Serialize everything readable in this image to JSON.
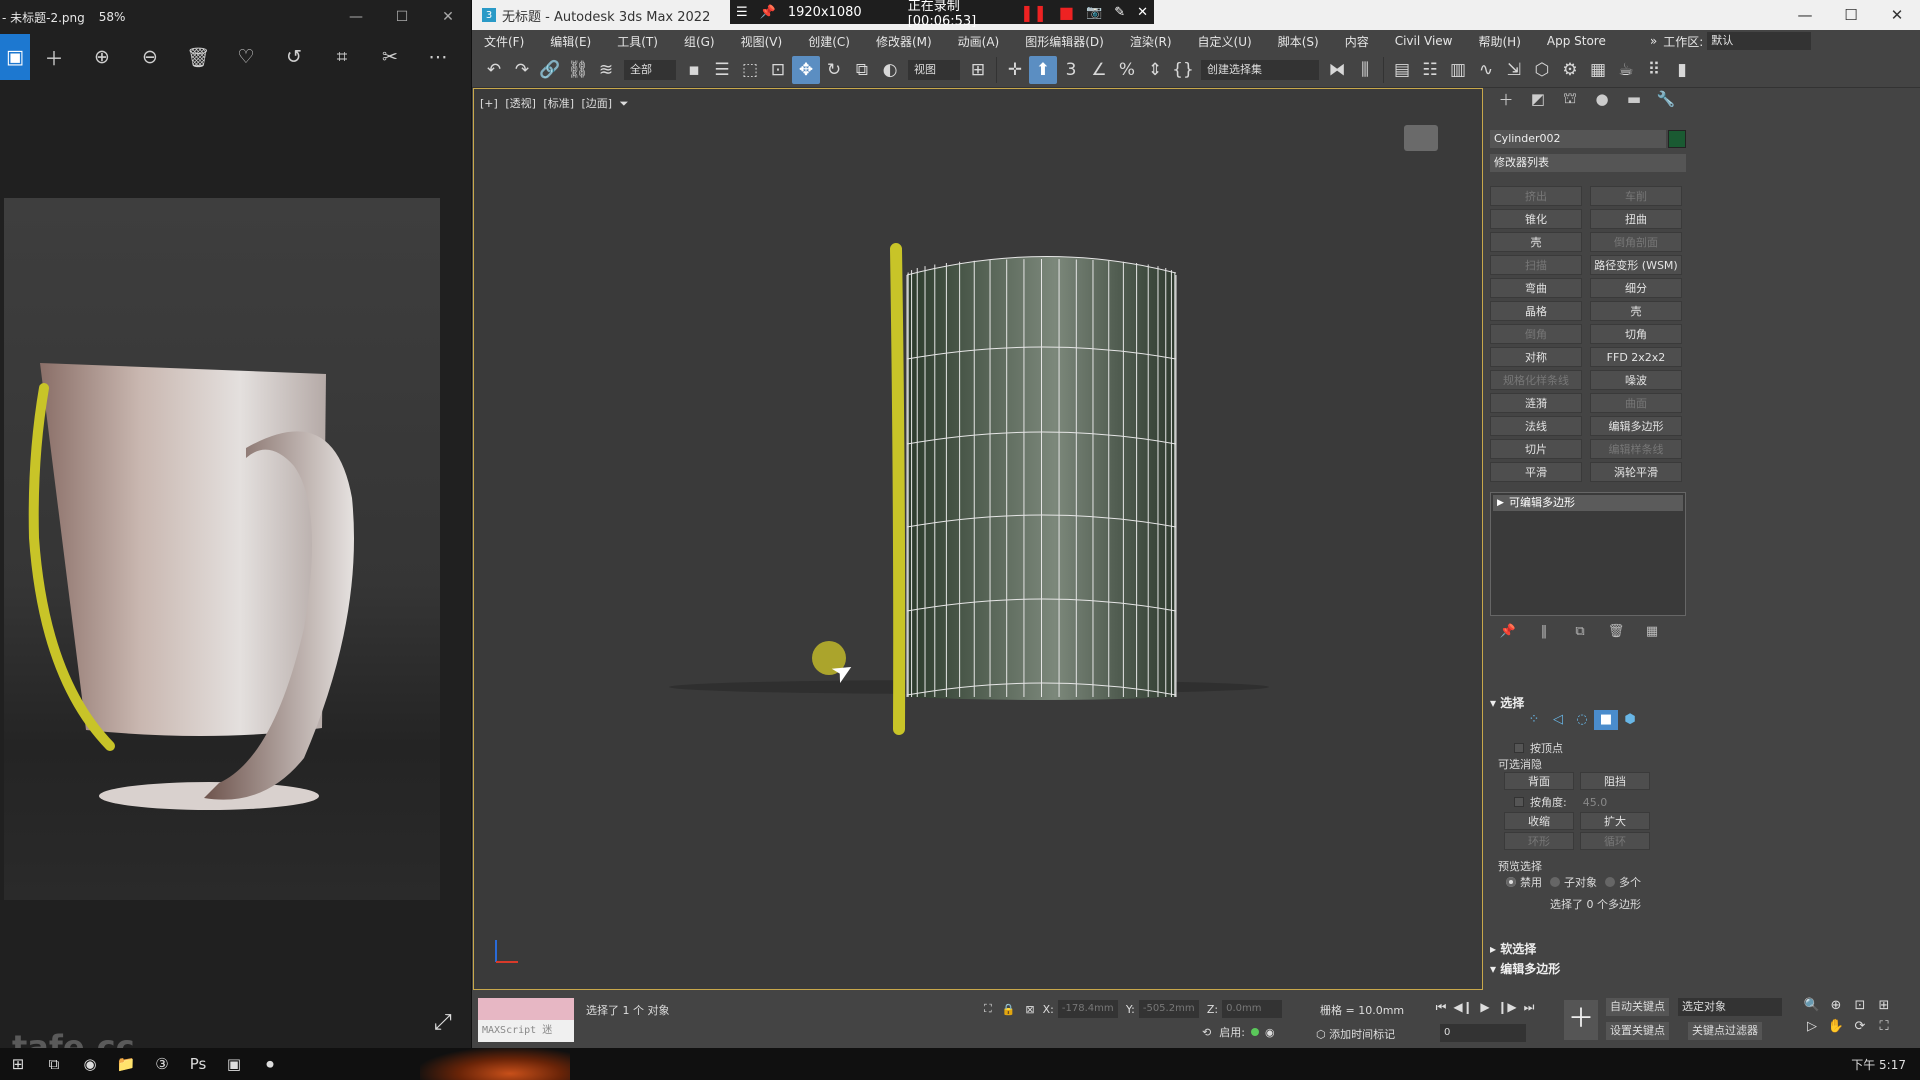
{
  "viewer": {
    "title": "- 未标题-2.png",
    "zoom": "58%",
    "watermark": "tafe.cc"
  },
  "max": {
    "title": "无标题 - Autodesk 3ds Max 2022",
    "recording": {
      "resolution": "1920x1080",
      "status": "正在录制 [00:06:53]"
    },
    "menu": [
      "文件(F)",
      "编辑(E)",
      "工具(T)",
      "组(G)",
      "视图(V)",
      "创建(C)",
      "修改器(M)",
      "动画(A)",
      "图形编辑器(D)",
      "渲染(R)",
      "自定义(U)",
      "脚本(S)",
      "内容",
      "Civil View",
      "帮助(H)",
      "App Store"
    ],
    "workspace_label": "工作区:",
    "workspace_value": "默认",
    "toolbar": {
      "filter": "全部",
      "ref_coord": "视图",
      "named_sel": "创建选择集"
    },
    "viewport": {
      "labels": [
        "[+]",
        "[透视]",
        "[标准]",
        "[边面]"
      ]
    },
    "cmd": {
      "object_name": "Cylinder002",
      "modifier_list": "修改器列表",
      "modifier_buttons": [
        {
          "label": "挤出",
          "enabled": false
        },
        {
          "label": "车削",
          "enabled": false
        },
        {
          "label": "锥化",
          "enabled": true
        },
        {
          "label": "扭曲",
          "enabled": true
        },
        {
          "label": "壳",
          "enabled": true
        },
        {
          "label": "倒角剖面",
          "enabled": false
        },
        {
          "label": "扫描",
          "enabled": false
        },
        {
          "label": "路径变形 (WSM)",
          "enabled": true
        },
        {
          "label": "弯曲",
          "enabled": true
        },
        {
          "label": "细分",
          "enabled": true
        },
        {
          "label": "晶格",
          "enabled": true
        },
        {
          "label": "壳",
          "enabled": true
        },
        {
          "label": "倒角",
          "enabled": false
        },
        {
          "label": "切角",
          "enabled": true
        },
        {
          "label": "对称",
          "enabled": true
        },
        {
          "label": "FFD 2x2x2",
          "enabled": true
        },
        {
          "label": "规格化样条线",
          "enabled": false
        },
        {
          "label": "噪波",
          "enabled": true
        },
        {
          "label": "涟漪",
          "enabled": true
        },
        {
          "label": "曲面",
          "enabled": false
        },
        {
          "label": "法线",
          "enabled": true
        },
        {
          "label": "编辑多边形",
          "enabled": true
        },
        {
          "label": "切片",
          "enabled": true
        },
        {
          "label": "编辑样条线",
          "enabled": false
        },
        {
          "label": "平滑",
          "enabled": true
        },
        {
          "label": "涡轮平滑",
          "enabled": true
        }
      ],
      "stack_item": "可编辑多边形",
      "selection": {
        "header": "选择",
        "by_vertex": "按顶点",
        "ignore_back": "可选消隐",
        "back_btn": "背面",
        "occlude_btn": "阻挡",
        "by_angle": "按角度:",
        "angle_val": "45.0",
        "shrink": "收缩",
        "grow": "扩大",
        "ring": "环形",
        "loop": "循环",
        "preview": "预览选择",
        "opt_disable": "禁用",
        "opt_sub": "子对象",
        "opt_multi": "多个",
        "count": "选择了 0 个多边形"
      },
      "soft_sel": "软选择",
      "edit_poly": "编辑多边形"
    },
    "status": {
      "maxscript": "MAXScript 迷",
      "message": "选择了 1 个 对象",
      "x_label": "X:",
      "x_val": "-178.4mm",
      "y_label": "Y:",
      "y_val": "-505.2mm",
      "z_label": "Z:",
      "z_val": "0.0mm",
      "grid": "栅格 = 10.0mm",
      "enable": "启用:",
      "add_time_tag": "添加时间标记",
      "frame": "0",
      "auto_key": "自动关键点",
      "selected_obj": "选定对象",
      "set_key": "设置关键点",
      "key_filters": "关键点过滤器"
    }
  },
  "taskbar": {
    "clock": "下午 5:17"
  },
  "colors": {
    "accent": "#5b8ec2",
    "highlight": "#c8c428",
    "recording_red": "#e22222"
  }
}
